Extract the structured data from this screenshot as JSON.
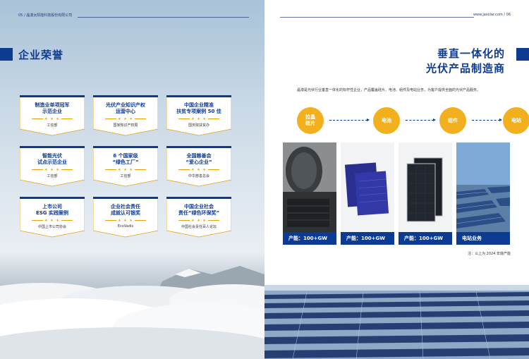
{
  "left_page": {
    "header": "05 / 晶澳太阳能科技股份有限公司",
    "section_title": "企业荣誉",
    "awards": [
      {
        "title": "制造业单项冠军\n示范企业",
        "stars": "★ ★ ★",
        "org": "工信部"
      },
      {
        "title": "光伏产业知识产权\n运营中心",
        "stars": "★ ★ ★",
        "org": "国家知识产权局"
      },
      {
        "title": "中国企业精准\n扶贫专项案例 50 佳",
        "stars": "★ ★ ★",
        "org": "国务院扶贫办"
      },
      {
        "title": "智能光伏\n试点示范企业",
        "stars": "★ ★ ★",
        "org": "工信部"
      },
      {
        "title": "6 个国家级\n“绿色工厂”",
        "stars": "★ ★ ★",
        "org": "工信部"
      },
      {
        "title": "全国慈善会\n“爱心企业”",
        "stars": "★ ★ ★",
        "org": "中华慈善总会"
      },
      {
        "title": "上市公司\nESG 实践案例",
        "stars": "★ ★ ★",
        "org": "中国上市公司协会"
      },
      {
        "title": "企业社会责任\n成就认可银奖",
        "stars": "★ ★ ★",
        "org": "EcoVadis"
      },
      {
        "title": "中国企业社会\n责任“绿色环保奖”",
        "stars": "★ ★ ★",
        "org": "中国社会责任百人论坛"
      }
    ]
  },
  "right_page": {
    "header": "www.jasolar.com / 06",
    "title_line1": "垂直一体化的",
    "title_line2": "光伏产品制造商",
    "intro": "晶澳是光伏行业垂直一体化的标杆性企业，产品覆盖硅片、电池、组件及电站业务，为客户提供全面的光伏产品服务。",
    "chain": [
      "拉晶\n硅片",
      "电池",
      "组件",
      "电站"
    ],
    "photos": [
      {
        "caption": "产能：100+GW",
        "icon": "silicon-wafer-photo"
      },
      {
        "caption": "产能：100+GW",
        "icon": "solar-cell-photo"
      },
      {
        "caption": "产能：100+GW",
        "icon": "solar-module-photo"
      },
      {
        "caption": "电站业务",
        "icon": "power-station-photo"
      }
    ],
    "note": "注：以上为 2024 年底产能"
  },
  "colors": {
    "brand_blue": "#0d3b91",
    "gold": "#f2b01e",
    "star_gold": "#e5a10f"
  }
}
